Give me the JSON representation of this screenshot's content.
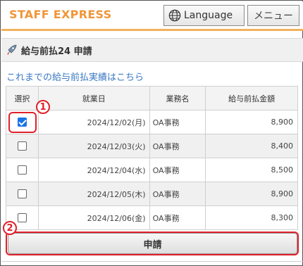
{
  "header": {
    "logo": "STAFF EXPRESS",
    "language_label": "Language",
    "menu_label": "メニュー"
  },
  "section": {
    "title": "給与前払24 申請",
    "history_link": "これまでの給与前払実績はこちら"
  },
  "table": {
    "columns": [
      "選択",
      "就業日",
      "業務名",
      "給与前払金額"
    ],
    "rows": [
      {
        "checked": true,
        "date": "2024/12/02(月)",
        "job": "OA事務",
        "amount": "8,900"
      },
      {
        "checked": false,
        "date": "2024/12/03(火)",
        "job": "OA事務",
        "amount": "8,400"
      },
      {
        "checked": false,
        "date": "2024/12/04(水)",
        "job": "OA事務",
        "amount": "8,500"
      },
      {
        "checked": false,
        "date": "2024/12/05(木)",
        "job": "OA事務",
        "amount": "8,900"
      },
      {
        "checked": false,
        "date": "2024/12/06(金)",
        "job": "OA事務",
        "amount": "8,300"
      }
    ]
  },
  "annotations": {
    "badge1": "1",
    "badge2": "2",
    "highlight_color": "#e0202a"
  },
  "submit_label": "申請",
  "icons": {
    "language": "globe-icon",
    "section": "rocket-icon"
  },
  "colors": {
    "brand": "#f0963a",
    "link": "#3a78c3",
    "checkbox_checked": "#1a73e8"
  }
}
